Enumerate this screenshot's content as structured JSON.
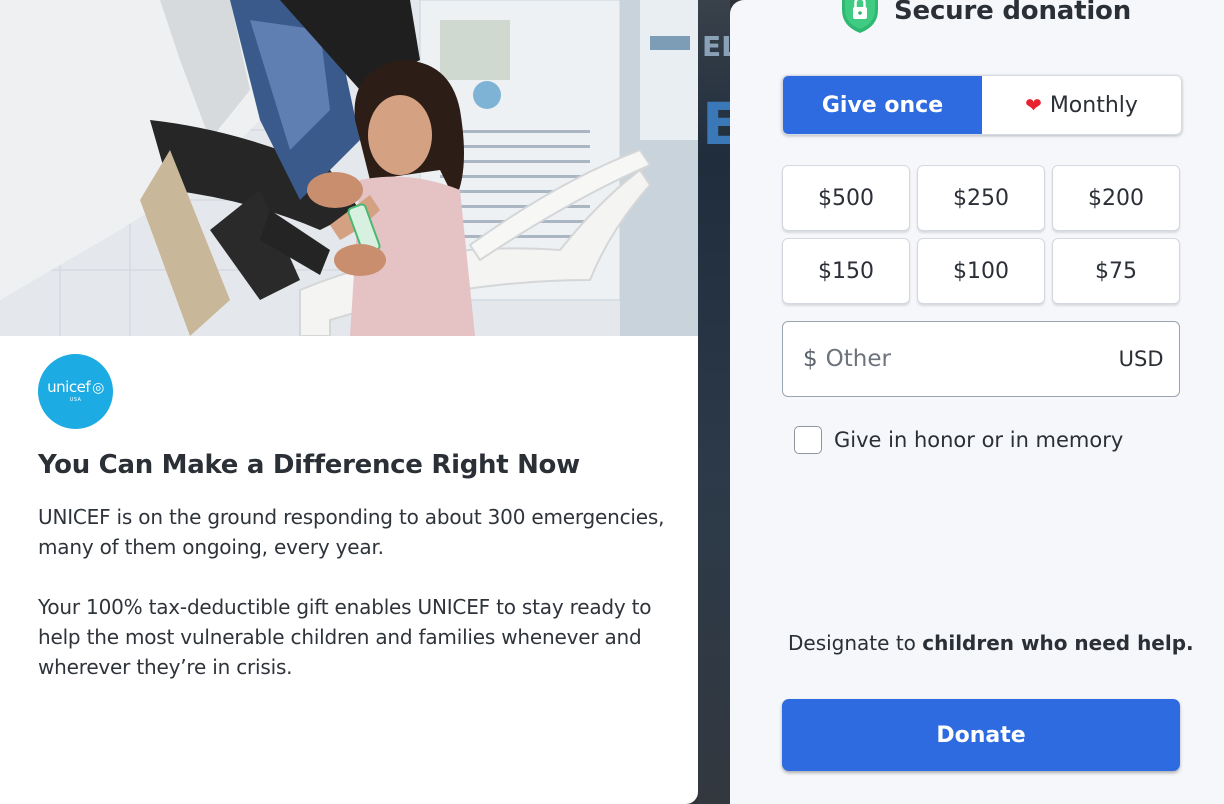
{
  "hero": {
    "image": "child-vaccination-photo"
  },
  "brand": {
    "logo_text": "unicef",
    "logo_sub": "USA",
    "logo_color": "#1cabe2"
  },
  "story": {
    "headline": "You Can Make a Difference Right Now",
    "paragraph1": "UNICEF is on the ground responding to about 300 emergencies, many of them ongoing, every year.",
    "paragraph2": "Your 100% tax-deductible gift enables UNICEF to stay ready to help the most vulnerable children and families whenever and wherever they’re in crisis."
  },
  "form": {
    "title": "Secure donation",
    "frequency": {
      "options": [
        {
          "label": "Give once",
          "active": true
        },
        {
          "label": "Monthly",
          "active": false,
          "icon": "heart-icon"
        }
      ]
    },
    "amounts": [
      "$500",
      "$250",
      "$200",
      "$150",
      "$100",
      "$75"
    ],
    "other": {
      "prefix": "$",
      "placeholder": "Other",
      "currency": "USD"
    },
    "honor_label": "Give in honor or in memory",
    "designate_prefix": "Designate to",
    "designate_target": "children who need help.",
    "donate_label": "Donate"
  },
  "colors": {
    "primary": "#2f6be0",
    "shield": "#2eb872",
    "heart": "#e8232f"
  }
}
